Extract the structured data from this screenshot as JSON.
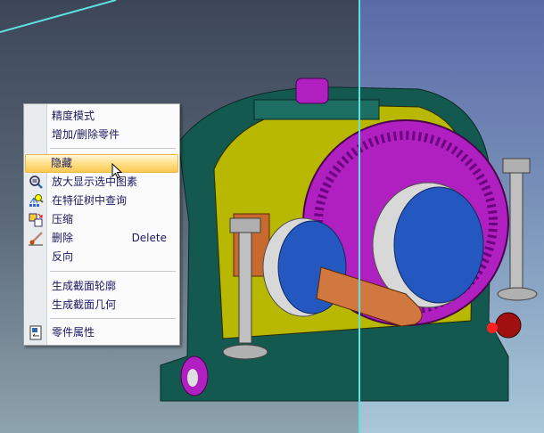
{
  "context_menu": {
    "items": [
      {
        "label": "精度模式",
        "icon": null
      },
      {
        "label": "增加/删除零件",
        "icon": null
      },
      {
        "label": "隐藏",
        "icon": null,
        "highlighted": true
      },
      {
        "label": "放大显示选中图素",
        "icon": "zoom-selection-icon"
      },
      {
        "label": "在特征树中查询",
        "icon": "tree-search-icon"
      },
      {
        "label": "压缩",
        "icon": "suppress-icon"
      },
      {
        "label": "删除",
        "shortcut": "Delete",
        "icon": "delete-brush-icon"
      },
      {
        "label": "反向",
        "icon": null
      },
      {
        "label": "生成截面轮廓",
        "icon": null
      },
      {
        "label": "生成截面几何",
        "icon": null
      },
      {
        "label": "零件属性",
        "icon": "properties-icon"
      }
    ]
  },
  "colors": {
    "housing": "#14594f",
    "gear": "#b020c0",
    "cavity": "#c8c800",
    "bearing": "#3060c8",
    "shaft": "#c86a30",
    "plane_edge": "#5fe0e0"
  }
}
